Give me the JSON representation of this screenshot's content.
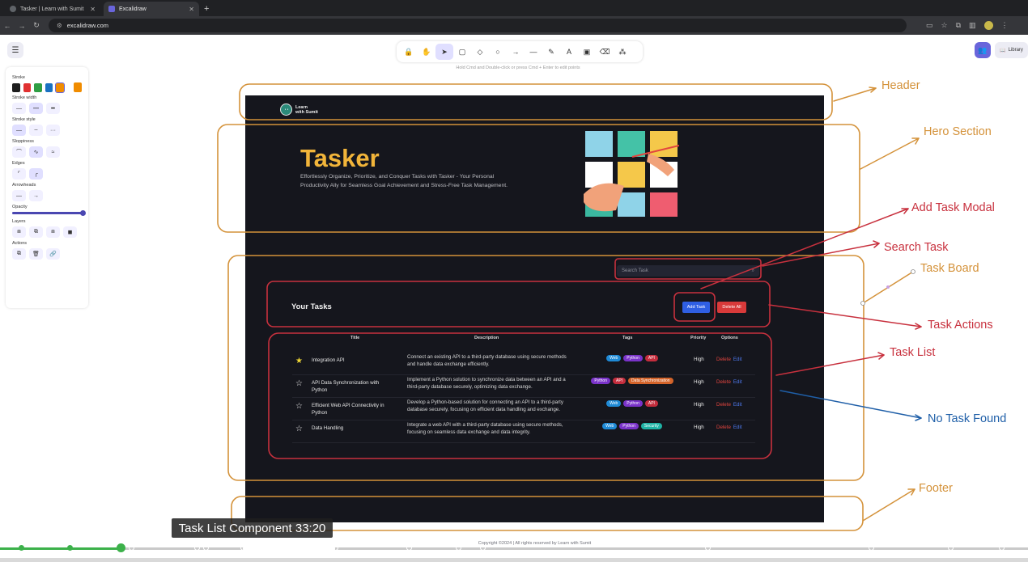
{
  "browser": {
    "tabs": [
      {
        "title": "Tasker | Learn with Sumit",
        "active": false
      },
      {
        "title": "Excalidraw",
        "active": true
      }
    ],
    "new_tab": "+",
    "url": "excalidraw.com"
  },
  "excalidraw": {
    "hint": "Hold Cmd and Double-click or press Cmd + Enter to edit points",
    "library_label": "Library",
    "tools": [
      "lock-icon",
      "hand-icon",
      "selection-icon",
      "rectangle-icon",
      "diamond-icon",
      "ellipse-icon",
      "arrow-icon",
      "line-icon",
      "pencil-icon",
      "text-icon",
      "image-icon",
      "eraser-icon",
      "extra-tools-icon"
    ],
    "tool_glyphs": [
      "🔒",
      "✋",
      "➤",
      "▢",
      "◇",
      "○",
      "→",
      "—",
      "✎",
      "A",
      "▣",
      "⌫",
      "⁂"
    ],
    "props": {
      "stroke": "Stroke",
      "stroke_width": "Stroke width",
      "stroke_style": "Stroke style",
      "sloppiness": "Sloppiness",
      "edges": "Edges",
      "arrowheads": "Arrowheads",
      "opacity": "Opacity",
      "layers": "Layers",
      "actions": "Actions",
      "stroke_colors": [
        "#1e1e1e",
        "#e03131",
        "#2f9e44",
        "#1971c2",
        "#f08c00"
      ],
      "current_color": "#f08c00"
    }
  },
  "app": {
    "logo_line1": "Learn",
    "logo_line2": "with Sumit",
    "hero_title": "Tasker",
    "hero_desc": "Effortlessly Organize, Prioritize, and Conquer Tasks with Tasker - Your Personal Productivity Ally for Seamless Goal Achievement and Stress-Free Task Management.",
    "search_placeholder": "Search Task",
    "section_title": "Your Tasks",
    "add_task": "Add Task",
    "delete_all": "Delete All",
    "columns": {
      "title": "Title",
      "description": "Description",
      "tags": "Tags",
      "priority": "Priority",
      "options": "Options"
    },
    "tasks": [
      {
        "favorite": true,
        "title": "Integration API",
        "description": "Connect an existing API to a third-party database using secure methods and handle data exchange efficiently.",
        "tags": [
          "Web",
          "Python",
          "API"
        ],
        "priority": "High",
        "delete": "Delete",
        "edit": "Edit"
      },
      {
        "favorite": false,
        "title": "API Data Synchronization with Python",
        "description": "Implement a Python solution to synchronize data between an API and a third-party database securely, optimizing data exchange.",
        "tags": [
          "Python",
          "API",
          "Data Synchronization"
        ],
        "priority": "High",
        "delete": "Delete",
        "edit": "Edit"
      },
      {
        "favorite": false,
        "title": "Efficient Web API Connectivity in Python",
        "description": "Develop a Python-based solution for connecting an API to a third-party database securely, focusing on efficient data handling and exchange.",
        "tags": [
          "Web",
          "Python",
          "API"
        ],
        "priority": "High",
        "delete": "Delete",
        "edit": "Edit"
      },
      {
        "favorite": false,
        "title": "Data Handling",
        "description": "Integrate a web API with a third-party database using secure methods, focusing on seamless data exchange and data integrity.",
        "tags": [
          "Web",
          "Python",
          "Security"
        ],
        "priority": "High",
        "delete": "Delete",
        "edit": "Edit"
      }
    ],
    "tag_colors": {
      "Web": "#1f8ad6",
      "Python": "#7a33c9",
      "API": "#c42d3d",
      "Data Synchronization": "#d4642a",
      "Security": "#1fb3a5"
    },
    "footer": "Copyright ©2024 | All rights reserved by Learn with Sumit"
  },
  "annotations": {
    "header": "Header",
    "hero": "Hero Section",
    "add_task_modal": "Add Task Modal",
    "search_task": "Search Task",
    "task_board": "Task Board",
    "task_actions": "Task Actions",
    "task_list": "Task List",
    "no_task_found": "No Task Found",
    "footer": "Footer"
  },
  "video": {
    "chapter_tooltip": "Task List Component 33:20",
    "progress": 0.117
  }
}
